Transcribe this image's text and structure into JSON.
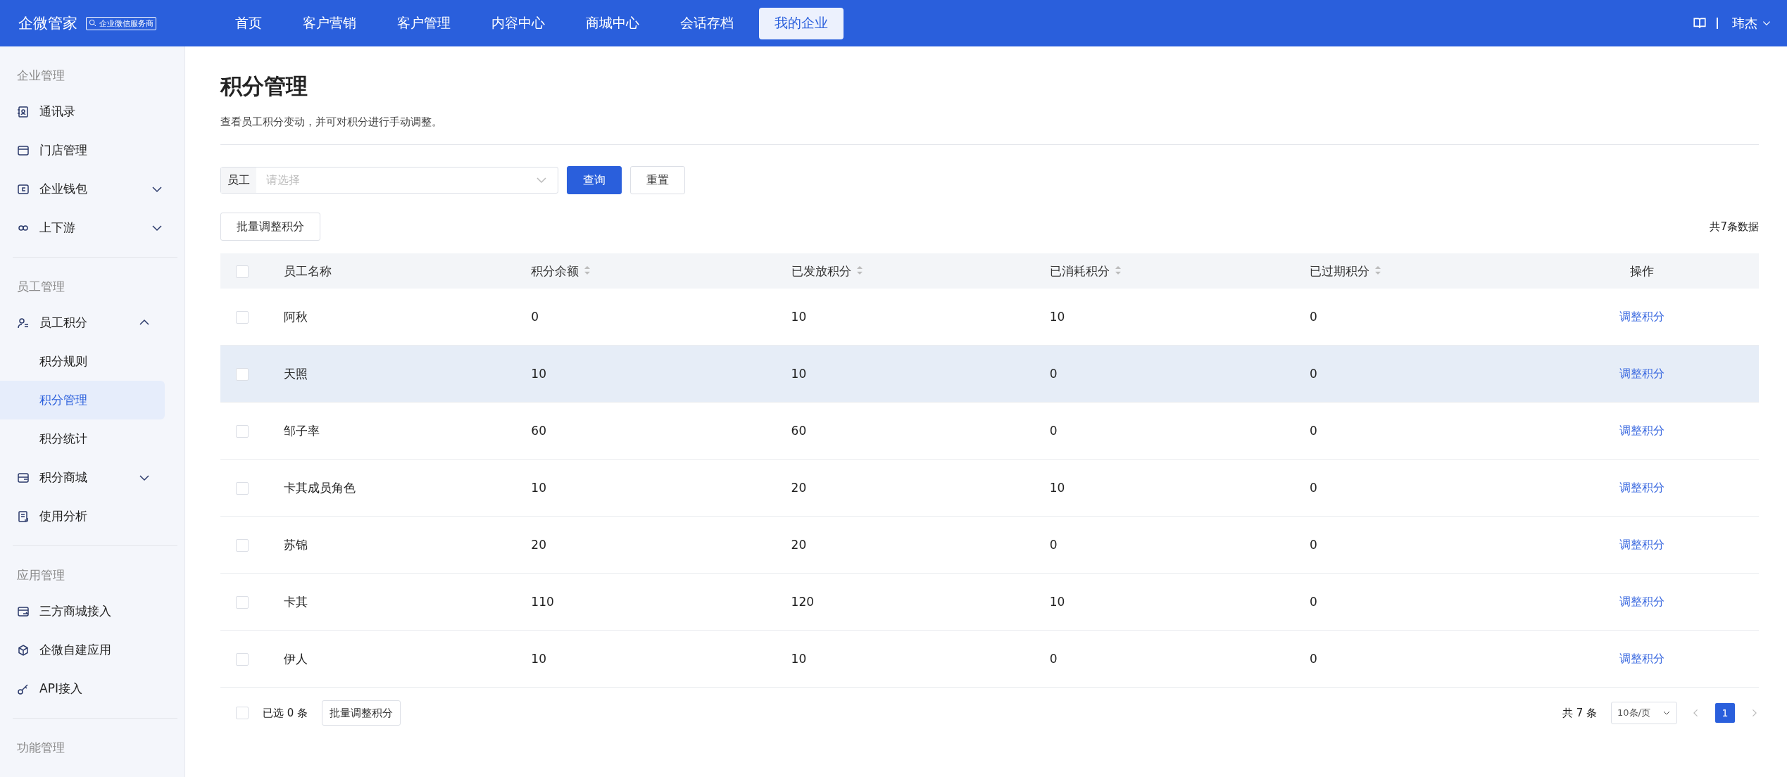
{
  "brand": {
    "name": "企微管家",
    "badge": "企业微信服务商"
  },
  "nav": [
    {
      "label": "首页",
      "selected": false
    },
    {
      "label": "客户营销",
      "selected": false
    },
    {
      "label": "客户管理",
      "selected": false
    },
    {
      "label": "内容中心",
      "selected": false
    },
    {
      "label": "商城中心",
      "selected": false
    },
    {
      "label": "会话存档",
      "selected": false
    },
    {
      "label": "我的企业",
      "selected": true
    }
  ],
  "user": {
    "name": "玮杰"
  },
  "sidebar": [
    {
      "title": "企业管理",
      "items": [
        {
          "label": "通讯录",
          "selected": false
        },
        {
          "label": "门店管理",
          "selected": false
        },
        {
          "label": "企业钱包",
          "selected": false,
          "expanded": false
        },
        {
          "label": "上下游",
          "selected": false,
          "expanded": false
        }
      ]
    },
    {
      "title": "员工管理",
      "items": [
        {
          "label": "员工积分",
          "selected": false,
          "expanded": true,
          "children": [
            {
              "label": "积分规则",
              "selected": false
            },
            {
              "label": "积分管理",
              "selected": true
            },
            {
              "label": "积分统计",
              "selected": false
            }
          ]
        },
        {
          "label": "积分商城",
          "selected": false,
          "expanded": false
        },
        {
          "label": "使用分析",
          "selected": false
        }
      ]
    },
    {
      "title": "应用管理",
      "items": [
        {
          "label": "三方商城接入",
          "selected": false
        },
        {
          "label": "企微自建应用",
          "selected": false
        },
        {
          "label": "API接入",
          "selected": false
        }
      ]
    },
    {
      "title": "功能管理"
    }
  ],
  "page": {
    "title": "积分管理",
    "description": "查看员工积分变动，并可对积分进行手动调整。"
  },
  "filter": {
    "label": "员工",
    "placeholder": "请选择",
    "query_button": "查询",
    "reset_button": "重置"
  },
  "batch_button": "批量调整积分",
  "total": "共7条数据",
  "table": {
    "select_all_checked": false,
    "columns": [
      {
        "label": "员工名称",
        "sortable": false
      },
      {
        "label": "积分余额",
        "sortable": true
      },
      {
        "label": "已发放积分",
        "sortable": true
      },
      {
        "label": "已消耗积分",
        "sortable": true
      },
      {
        "label": "已过期积分",
        "sortable": true
      },
      {
        "label": "操作",
        "sortable": false
      }
    ],
    "rows": [
      {
        "cells": [
          "阿秋",
          "0",
          "10",
          "10",
          "0"
        ],
        "action": "调整积分",
        "checked": false,
        "hovered": false
      },
      {
        "cells": [
          "天照",
          "10",
          "10",
          "0",
          "0"
        ],
        "action": "调整积分",
        "checked": false,
        "hovered": true
      },
      {
        "cells": [
          "邹子率",
          "60",
          "60",
          "0",
          "0"
        ],
        "action": "调整积分",
        "checked": false,
        "hovered": false
      },
      {
        "cells": [
          "卡其成员角色",
          "10",
          "20",
          "10",
          "0"
        ],
        "action": "调整积分",
        "checked": false,
        "hovered": false
      },
      {
        "cells": [
          "苏锦",
          "20",
          "20",
          "0",
          "0"
        ],
        "action": "调整积分",
        "checked": false,
        "hovered": false
      },
      {
        "cells": [
          "卡其",
          "110",
          "120",
          "10",
          "0"
        ],
        "action": "调整积分",
        "checked": false,
        "hovered": false
      },
      {
        "cells": [
          "伊人",
          "10",
          "10",
          "0",
          "0"
        ],
        "action": "调整积分",
        "checked": false,
        "hovered": false
      }
    ]
  },
  "footer": {
    "select_all_checked": false,
    "selected_count": "已选 0 条",
    "batch_button": "批量调整积分",
    "total": "共 7 条",
    "page_size": "10条/页",
    "pages": [
      {
        "label": "1",
        "selected": true
      }
    ]
  }
}
